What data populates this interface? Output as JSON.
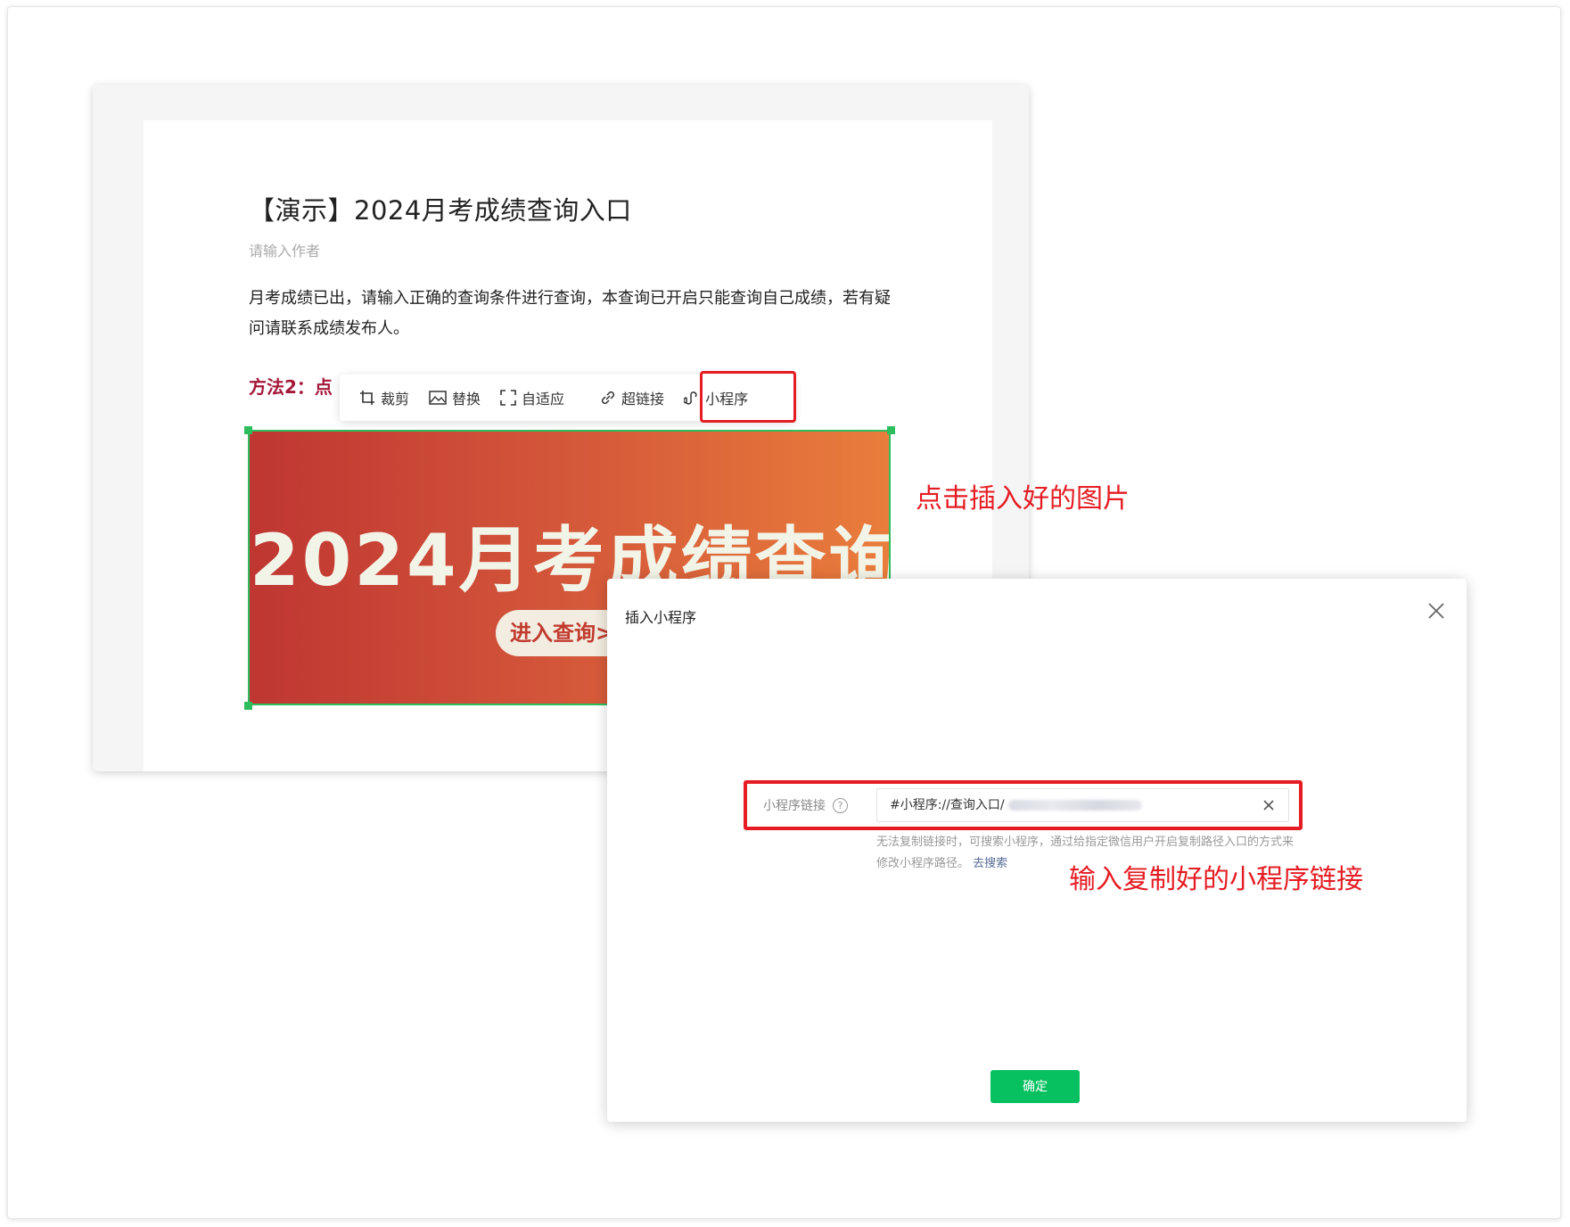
{
  "article": {
    "title": "【演示】2024月考成绩查询入口",
    "author_placeholder": "请输入作者",
    "paragraph": "月考成绩已出，请输入正确的查询条件进行查询，本查询已开启只能查询自己成绩，若有疑问请联系成绩发布人。",
    "method_heading": "方法2：点"
  },
  "toolbar": {
    "crop": "裁剪",
    "replace": "替换",
    "fit": "自适应",
    "hyperlink": "超链接",
    "miniprogram": "小程序"
  },
  "banner": {
    "title": "2024月考成绩查询",
    "button": "进入查询>"
  },
  "annotations": {
    "click_image": "点击插入好的图片",
    "input_link": "输入复制好的小程序链接"
  },
  "dialog": {
    "title": "插入小程序",
    "field_label": "小程序链接",
    "help_icon": "?",
    "input_value": "#小程序://查询入口/",
    "hint_text": "无法复制链接时，可搜索小程序，通过给指定微信用户开启复制路径入口的方式来修改小程序路径。",
    "hint_link": "去搜索",
    "confirm_label": "确定"
  },
  "colors": {
    "highlight": "#e51c23",
    "accent_green": "#07c160",
    "selection_green": "#2dbd5c",
    "heading_red": "#a5183a"
  }
}
